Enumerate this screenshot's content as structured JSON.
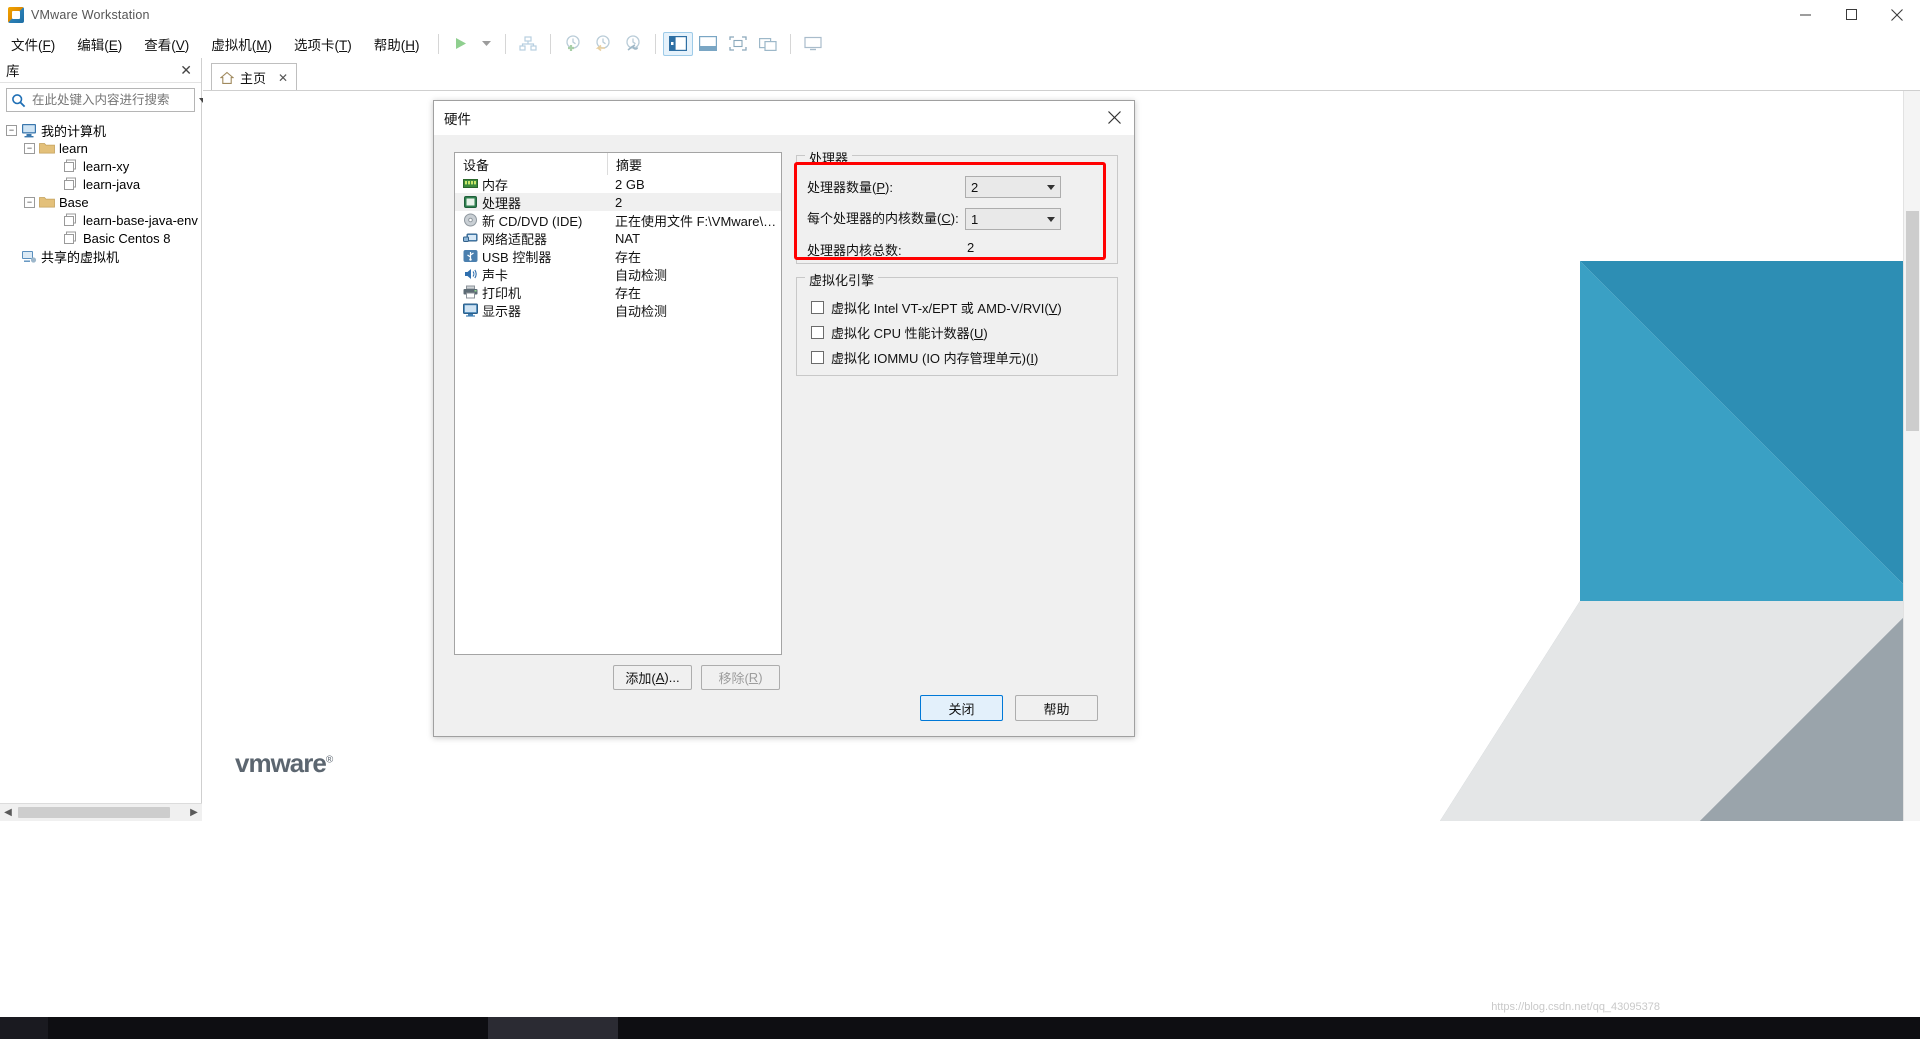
{
  "window": {
    "title": "VMware Workstation",
    "app_icon": "vmware-icon",
    "minimize": "minimize-icon",
    "maximize": "maximize-icon",
    "close": "close-icon"
  },
  "menubar": [
    {
      "label": "文件(F)",
      "accel": "F",
      "pre": "文件(",
      "post": ")"
    },
    {
      "label": "编辑(E)",
      "accel": "E",
      "pre": "编辑(",
      "post": ")"
    },
    {
      "label": "查看(V)",
      "accel": "V",
      "pre": "查看(",
      "post": ")"
    },
    {
      "label": "虚拟机(M)",
      "accel": "M",
      "pre": "虚拟机(",
      "post": ")"
    },
    {
      "label": "选项卡(T)",
      "accel": "T",
      "pre": "选项卡(",
      "post": ")"
    },
    {
      "label": "帮助(H)",
      "accel": "H",
      "pre": "帮助(",
      "post": ")"
    }
  ],
  "toolbar": {
    "items": [
      {
        "name": "power-on-button",
        "glyph": "▶"
      },
      {
        "name": "power-dropdown-button",
        "glyph": "▼"
      },
      {
        "name": "manage-snapshots-button",
        "glyph": "snapshot"
      },
      {
        "name": "take-snapshot-button",
        "glyph": "clock-plus"
      },
      {
        "name": "revert-snapshot-button",
        "glyph": "clock-back"
      },
      {
        "name": "snapshot-manager-button",
        "glyph": "clock-wrench"
      },
      {
        "name": "show-library-button",
        "glyph": "panel-left"
      },
      {
        "name": "show-thumbnail-button",
        "glyph": "panel-bottom"
      },
      {
        "name": "full-screen-button",
        "glyph": "fullscreen"
      },
      {
        "name": "unity-mode-button",
        "glyph": "unity"
      },
      {
        "name": "preferences-button",
        "glyph": "console"
      }
    ]
  },
  "sidebar": {
    "header": "库",
    "close_icon": "close-icon",
    "search": {
      "placeholder": "在此处键入内容进行搜索",
      "value": "",
      "icon": "search-icon",
      "dropdown_icon": "chevron-down-icon"
    },
    "tree": [
      {
        "label": "我的计算机",
        "level": 0,
        "icon": "computer-icon",
        "expander": "−"
      },
      {
        "label": "learn",
        "level": 1,
        "icon": "folder-icon",
        "expander": "−"
      },
      {
        "label": "learn-xy",
        "level": 2,
        "icon": "vm-icon",
        "expander": ""
      },
      {
        "label": "learn-java",
        "level": 2,
        "icon": "vm-icon",
        "expander": ""
      },
      {
        "label": "Base",
        "level": 1,
        "icon": "folder-icon",
        "expander": "−"
      },
      {
        "label": "learn-base-java-env",
        "level": 2,
        "icon": "vm-icon",
        "expander": ""
      },
      {
        "label": "Basic Centos 8",
        "level": 2,
        "icon": "vm-icon",
        "expander": ""
      },
      {
        "label": "共享的虚拟机",
        "level": 0,
        "icon": "shared-vms-icon",
        "expander": ""
      }
    ]
  },
  "main": {
    "tab": {
      "label": "主页",
      "icon": "home-icon",
      "close_icon": "close-icon"
    },
    "logo_text": "vmware",
    "logo_mark": "®"
  },
  "dialog": {
    "title": "硬件",
    "close_icon": "close-icon",
    "device_table": {
      "columns": [
        "设备",
        "摘要"
      ],
      "rows": [
        {
          "device": "内存",
          "summary": "2 GB",
          "icon": "memory-icon",
          "selected": false
        },
        {
          "device": "处理器",
          "summary": "2",
          "icon": "processor-icon",
          "selected": true
        },
        {
          "device": "新 CD/DVD (IDE)",
          "summary": "正在使用文件 F:\\VMware\\Ce…",
          "icon": "cd-dvd-icon",
          "selected": false
        },
        {
          "device": "网络适配器",
          "summary": "NAT",
          "icon": "network-icon",
          "selected": false
        },
        {
          "device": "USB 控制器",
          "summary": "存在",
          "icon": "usb-icon",
          "selected": false
        },
        {
          "device": "声卡",
          "summary": "自动检测",
          "icon": "sound-card-icon",
          "selected": false
        },
        {
          "device": "打印机",
          "summary": "存在",
          "icon": "printer-icon",
          "selected": false
        },
        {
          "device": "显示器",
          "summary": "自动检测",
          "icon": "display-icon",
          "selected": false
        }
      ]
    },
    "buttons": {
      "add": {
        "pre": "添加(",
        "accel": "A",
        "post": ")..."
      },
      "remove": {
        "pre": "移除(",
        "accel": "R",
        "post": ")"
      },
      "close": "关闭",
      "help": "帮助"
    },
    "processor_group": {
      "legend": "处理器",
      "highlight_color": "#ff0000",
      "fields": [
        {
          "label_pre": "处理器数量(",
          "accel": "P",
          "label_post": "):",
          "value": "2",
          "type": "combobox"
        },
        {
          "label_pre": "每个处理器的内核数量(",
          "accel": "C",
          "label_post": "):",
          "value": "1",
          "type": "combobox"
        },
        {
          "label_pre": "处理器内核总数:",
          "accel": "",
          "label_post": "",
          "value": "2",
          "type": "text"
        }
      ]
    },
    "virtualization_group": {
      "legend": "虚拟化引擎",
      "checkboxes": [
        {
          "pre": "虚拟化 Intel VT-x/EPT 或 AMD-V/RVI(",
          "accel": "V",
          "post": ")",
          "checked": false
        },
        {
          "pre": "虚拟化 CPU 性能计数器(",
          "accel": "U",
          "post": ")",
          "checked": false
        },
        {
          "pre": "虚拟化 IOMMU (IO 内存管理单元)(",
          "accel": "I",
          "post": ")",
          "checked": false
        }
      ]
    }
  },
  "watermark": "https://blog.csdn.net/qq_43095378",
  "colors": {
    "accent": "#0078d7",
    "highlight": "#ff0000",
    "dialog_bg": "#f0f0f0",
    "deco_teal": "#3a9bbf",
    "deco_grey": "#9aa4ab"
  }
}
